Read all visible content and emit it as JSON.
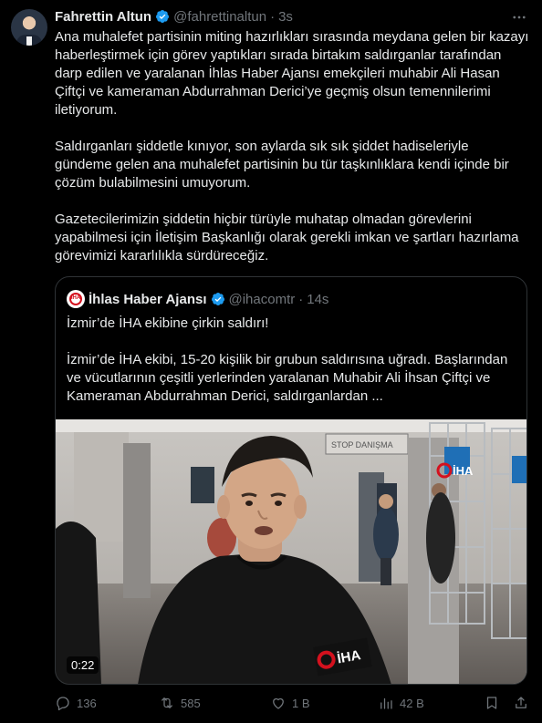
{
  "author": {
    "name": "Fahrettin Altun",
    "handle": "@fahrettinaltun",
    "separator": "·",
    "time": "3s"
  },
  "tweet": {
    "paragraphs": [
      "Ana muhalefet partisinin miting hazırlıkları sırasında meydana gelen bir kazayı haberleştirmek için görev yaptıkları sırada birtakım saldırganlar tarafından darp edilen ve yaralanan İhlas Haber Ajansı emekçileri muhabir Ali Hasan Çiftçi ve kameraman Abdurrahman Derici’ye geçmiş olsun temennilerimi iletiyorum.",
      "Saldırganları şiddetle kınıyor, son aylarda sık sık şiddet hadiseleriyle gündeme gelen ana muhalefet partisinin bu tür taşkınlıklara kendi içinde bir çözüm bulabilmesini umuyorum.",
      "Gazetecilerimizin şiddetin hiçbir türüyle muhatap olmadan görevlerini yapabilmesi için İletişim Başkanlığı olarak gerekli imkan ve şartları hazırlama görevimizi kararlılıkla sürdüreceğiz."
    ]
  },
  "quote": {
    "avatar_text": "İHA",
    "name": "İhlas Haber Ajansı",
    "handle": "@ihacomtr",
    "separator": "·",
    "time": "14s",
    "paragraphs": [
      "İzmir’de İHA ekibine çirkin saldırı!",
      "İzmir’de İHA ekibi, 15-20 kişilik bir grubun saldırısına uğradı. Başlarından ve vücutlarının çeşitli yerlerinden yaralanan Muhabir Ali İhsan Çiftçi ve Kameraman Abdurrahman Derici, saldırganlardan ..."
    ],
    "video": {
      "duration": "0:22",
      "sign_text": "STOP DANIŞMA",
      "watermark_top": "İHA",
      "watermark_bottom": "İHA"
    }
  },
  "actions": {
    "replies": "136",
    "retweets": "585",
    "likes": "1 B",
    "views": "42 B"
  },
  "colors": {
    "background": "#000000",
    "text": "#e7e9ea",
    "muted": "#71767b",
    "verified": "#1d9bf0",
    "border": "#2f3336",
    "iha_red": "#d4111e"
  }
}
